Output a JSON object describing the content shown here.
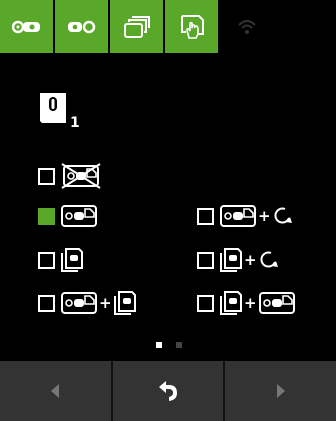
{
  "top_tabs": [
    {
      "icon": "tape-cartridge-icon",
      "active": true
    },
    {
      "icon": "tape-reel-icon",
      "active": true
    },
    {
      "icon": "stacked-pages-icon",
      "active": true
    },
    {
      "icon": "hand-touch-icon",
      "active": true
    },
    {
      "icon": "wifi-icon",
      "active": false
    }
  ],
  "title": {
    "icon": "cassette-icon",
    "subscript": "1"
  },
  "options": [
    {
      "id": "none",
      "checked": false,
      "icons": [
        "tape-crossed-icon"
      ]
    },
    {
      "id": "tape-only",
      "checked": true,
      "icons": [
        "tape-label-icon"
      ]
    },
    {
      "id": "tape-rotate",
      "checked": false,
      "icons": [
        "tape-label-icon",
        "plus",
        "rotate-icon"
      ]
    },
    {
      "id": "page-only",
      "checked": false,
      "icons": [
        "page-label-icon"
      ]
    },
    {
      "id": "page-rotate",
      "checked": false,
      "icons": [
        "page-label-icon",
        "plus",
        "rotate-icon"
      ]
    },
    {
      "id": "tape-page",
      "checked": false,
      "icons": [
        "tape-label-icon",
        "plus",
        "page-label-icon"
      ]
    },
    {
      "id": "page-tape",
      "checked": false,
      "icons": [
        "page-label-icon",
        "plus",
        "tape-label-icon"
      ]
    }
  ],
  "plus_text": "+",
  "pagination": {
    "pages": 2,
    "current": 1
  },
  "bottom": [
    "left-arrow-icon",
    "back-icon",
    "right-arrow-icon"
  ],
  "colors": {
    "accent": "#5aa82a",
    "bar": "#333333"
  }
}
